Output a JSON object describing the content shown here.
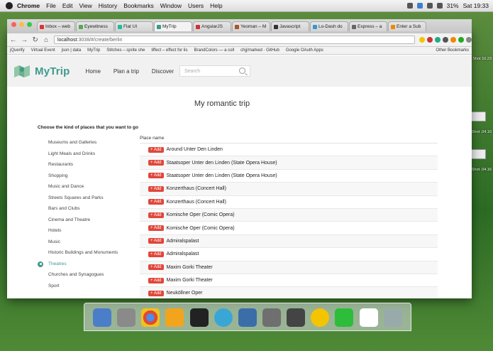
{
  "menubar": {
    "app": "Chrome",
    "items": [
      "File",
      "Edit",
      "View",
      "History",
      "Bookmarks",
      "Window",
      "Users",
      "Help"
    ],
    "battery": "31%",
    "clock": "Sat 19:33"
  },
  "browser": {
    "tabs": [
      {
        "label": "Inbox – web",
        "color": "#d33"
      },
      {
        "label": "Eyewitness",
        "color": "#5a5"
      },
      {
        "label": "Flat UI",
        "color": "#1abc9c"
      },
      {
        "label": "MyTrip",
        "color": "#3d9a8b"
      },
      {
        "label": "AngularJS",
        "color": "#c33"
      },
      {
        "label": "Yeoman – M",
        "color": "#a52"
      },
      {
        "label": "Javascript",
        "color": "#333"
      },
      {
        "label": "Lo-Dash do",
        "color": "#39c"
      },
      {
        "label": "Express – a",
        "color": "#666"
      },
      {
        "label": "Enter a Sub",
        "color": "#e80"
      }
    ],
    "url_host": "localhost",
    "url_path": ":3038/#/create/berlin",
    "bookmarks": [
      "jQuerify",
      "Virtual Event",
      "json | data",
      "MyTrip",
      "Stitches – sprite she",
      "liffect – effect for lis",
      "BrandColors — a coll",
      "chjj/marked · GitHub",
      "Google OAuth Apps"
    ],
    "other_bookmarks": "Other Bookmarks"
  },
  "app": {
    "logo": "MyTrip",
    "nav": [
      "Home",
      "Plan a trip",
      "Discover"
    ],
    "search_placeholder": "Search",
    "trip_title": "My romantic trip",
    "choose_label": "Choose the kind of places that you want to go",
    "categories": [
      "Museums and Galleries",
      "Light Meals and Drinks",
      "Restaurants",
      "Shopping",
      "Music and Dance",
      "Streets Squares and Parks",
      "Bars and Clubs",
      "Cinema and Theatre",
      "Hotels",
      "Music",
      "Historic Buildings and Monuments",
      "Theatres",
      "Churches and Synagogues",
      "Sport"
    ],
    "active_category": "Theatres",
    "place_header": "Place name",
    "add_label": "+ Add",
    "places": [
      "Around Unter Den Linden",
      "Staatsoper Unter den Linden (State Opera House)",
      "Staatsoper Unter den Linden (State Opera House)",
      "Konzerthaus (Concert Hall)",
      "Konzerthaus (Concert Hall)",
      "Komische Oper (Comic Opera)",
      "Komische Oper (Comic Opera)",
      "Admiralspalast",
      "Admiralspalast",
      "Maxim Gorki Theater",
      "Maxim Gorki Theater",
      "Neuköllner Oper"
    ]
  },
  "desktop": {
    "labels": [
      "n Shot 10.23",
      "n Shot .04.10",
      "n Shot .04.16"
    ]
  },
  "dock": [
    "#4a7ec9",
    "#8a8a8a",
    "#e04a32",
    "#f2a51c",
    "#222",
    "#3aa6d6",
    "#3b6ea8",
    "#6f6f6f",
    "#444",
    "#f5c400",
    "#2dbd3a",
    "#ffffff",
    "#9aa"
  ]
}
